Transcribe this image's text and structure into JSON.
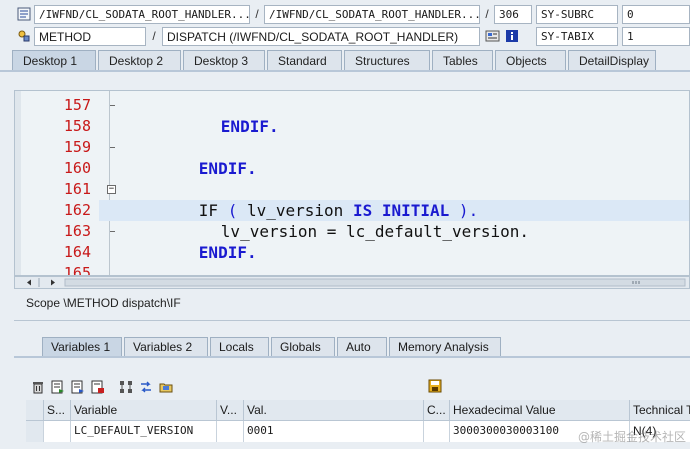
{
  "header": {
    "row1": {
      "program": "/IWFND/CL_SODATA_ROOT_HANDLER...",
      "include": "/IWFND/CL_SODATA_ROOT_HANDLER...",
      "line": "306",
      "sysfield": "SY-SUBRC",
      "sysvalue": "0"
    },
    "row2": {
      "event_type": "METHOD",
      "event": "DISPATCH (/IWFND/CL_SODATA_ROOT_HANDLER)",
      "sysfield": "SY-TABIX",
      "sysvalue": "1"
    },
    "separator": "/"
  },
  "desktop_tabs": [
    {
      "label": "Desktop 1"
    },
    {
      "label": "Desktop 2"
    },
    {
      "label": "Desktop 3"
    },
    {
      "label": "Standard"
    },
    {
      "label": "Structures"
    },
    {
      "label": "Tables"
    },
    {
      "label": "Objects"
    },
    {
      "label": "DetailDisplay"
    }
  ],
  "editor": {
    "line_numbers": [
      "157",
      "158",
      "159",
      "160",
      "161",
      "162",
      "163",
      "164",
      "165"
    ],
    "lines": [
      {
        "indent": "  ",
        "kw": "ENDIF",
        "rest": "."
      },
      {
        "indent": "",
        "kw": "",
        "rest": ""
      },
      {
        "indent": "",
        "kw": "ENDIF",
        "rest": "."
      },
      {
        "indent": "",
        "kw": "",
        "rest": ""
      },
      {
        "indent": "",
        "kw": "IF",
        "rest": ""
      },
      {
        "indent": "  ",
        "kw": "",
        "rest": "lv_version = lc_default_version."
      },
      {
        "indent": "",
        "kw": "ENDIF",
        "rest": "."
      },
      {
        "indent": "",
        "kw": "",
        "rest": ""
      },
      {
        "indent": "",
        "kw": "",
        "rest": ""
      }
    ],
    "if_line": {
      "open": "(",
      "var": "lv_version",
      "cond": "IS INITIAL",
      "close": ")",
      "dot": "."
    },
    "current_line_index": 5
  },
  "scope": "Scope \\METHOD dispatch\\IF",
  "variable_tabs": [
    {
      "label": "Variables 1"
    },
    {
      "label": "Variables 2"
    },
    {
      "label": "Locals"
    },
    {
      "label": "Globals"
    },
    {
      "label": "Auto"
    },
    {
      "label": "Memory Analysis"
    }
  ],
  "grid": {
    "headers": [
      "S...",
      "Variable",
      "V...",
      "Val.",
      "C...",
      "Hexadecimal Value",
      "Technical T"
    ],
    "rows": [
      {
        "s": "",
        "variable": "LC_DEFAULT_VERSION",
        "v": "",
        "val": "0001",
        "c": "",
        "hex": "3000300030003100",
        "tech": "N(4)"
      }
    ]
  },
  "watermark": "@稀土掘金技术社区",
  "colors": {
    "keyword": "#1a1ad0",
    "line_number": "#c81919",
    "current_line": "#dbe8f6"
  }
}
